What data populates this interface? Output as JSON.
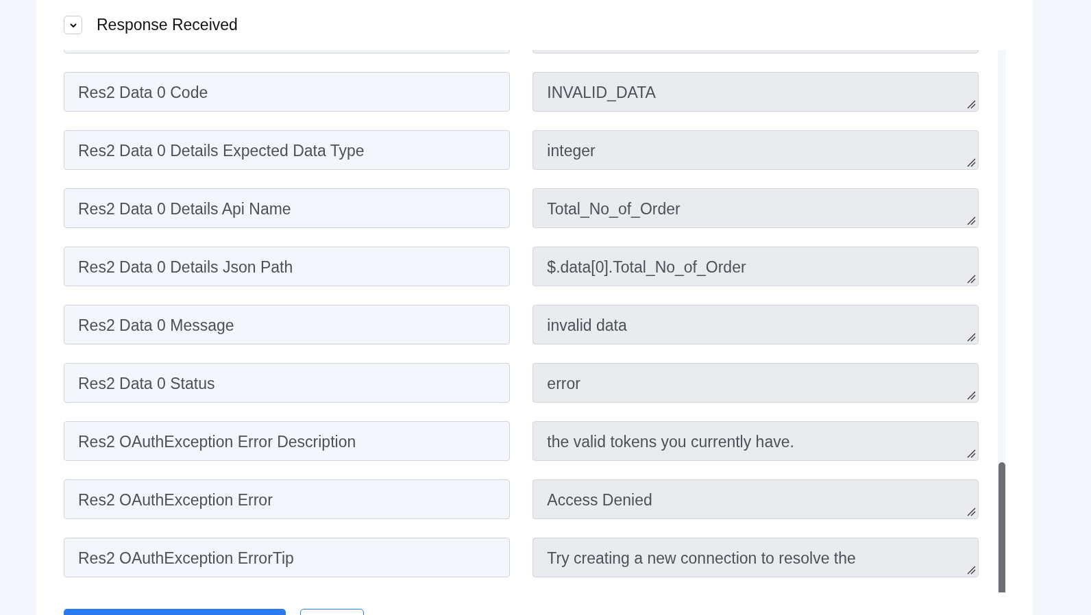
{
  "section": {
    "title": "Response Received",
    "expanded": true
  },
  "rows": [
    {
      "label": "Res2 Data 0 Code",
      "value": "INVALID_DATA"
    },
    {
      "label": "Res2 Data 0 Details Expected Data Type",
      "value": "integer"
    },
    {
      "label": "Res2 Data 0 Details Api Name",
      "value": "Total_No_of_Order"
    },
    {
      "label": "Res2 Data 0 Details Json Path",
      "value": "$.data[0].Total_No_of_Order"
    },
    {
      "label": "Res2 Data 0 Message",
      "value": "invalid data"
    },
    {
      "label": "Res2 Data 0 Status",
      "value": "error"
    },
    {
      "label": "Res2 OAuthException Error Description",
      "value": "the valid tokens you currently have."
    },
    {
      "label": "Res2 OAuthException Error",
      "value": "Access Denied"
    },
    {
      "label": "Res2 OAuthException ErrorTip",
      "value": "Try creating a new connection to resolve the"
    }
  ]
}
